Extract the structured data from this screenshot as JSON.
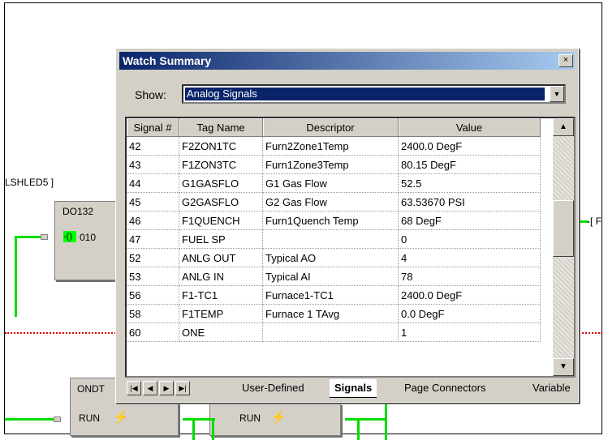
{
  "background": {
    "label_shled": "LSHLED5 ]",
    "block_do": "DO132",
    "block_do_out": "010",
    "right_label": "-[ F",
    "block_ondt": "ONDT",
    "run_label_1": "RUN",
    "run_label_2": "RUN",
    "wire_color": "#00dd00",
    "dotted_color": "#dd0000"
  },
  "window": {
    "title": "Watch Summary",
    "close_glyph": "×",
    "show_label": "Show:",
    "show_value": "Analog Signals",
    "dropdown_glyph": "▼"
  },
  "table": {
    "columns": [
      "Signal #",
      "Tag Name",
      "Descriptor",
      "Value"
    ],
    "rows": [
      [
        "42",
        "F2ZON1TC",
        "Furn2Zone1Temp",
        "2400.0 DegF"
      ],
      [
        "43",
        "F1ZON3TC",
        "Furn1Zone3Temp",
        "80.15 DegF"
      ],
      [
        "44",
        "G1GASFLO",
        "G1 Gas Flow",
        "52.5"
      ],
      [
        "45",
        "G2GASFLO",
        "G2 Gas Flow",
        "63.53670 PSI"
      ],
      [
        "46",
        "F1QUENCH",
        "Furn1Quench Temp",
        "68 DegF"
      ],
      [
        "47",
        "FUEL SP",
        "",
        "0"
      ],
      [
        "52",
        "ANLG OUT",
        "Typical AO",
        "4"
      ],
      [
        "53",
        "ANLG IN",
        "Typical AI",
        "78"
      ],
      [
        "56",
        "F1-TC1",
        "Furnace1-TC1",
        "2400.0 DegF"
      ],
      [
        "58",
        "F1TEMP",
        "Furnace 1 TAvg",
        "0.0 DegF"
      ],
      [
        "60",
        "ONE",
        "",
        "1"
      ]
    ],
    "scroll_up_glyph": "▲",
    "scroll_down_glyph": "▼"
  },
  "tabs": {
    "nav": [
      "|◀",
      "◀",
      "▶",
      "▶|"
    ],
    "items": [
      "User-Defined",
      "Signals",
      "Page Connectors",
      "Variable"
    ],
    "active": "Signals"
  }
}
